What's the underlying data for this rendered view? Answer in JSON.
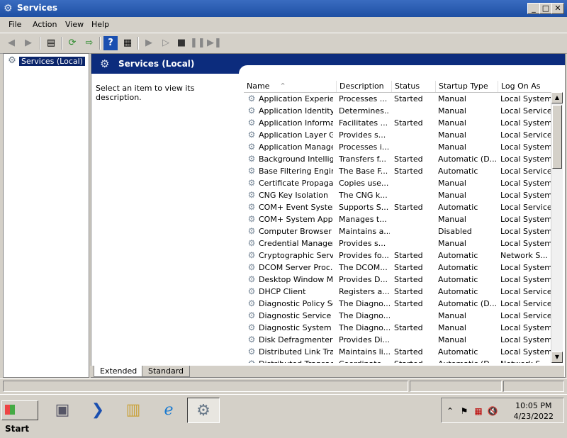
{
  "window": {
    "title": "Services"
  },
  "menu": [
    "File",
    "Action",
    "View",
    "Help"
  ],
  "tree": {
    "selected": "Services (Local)"
  },
  "header": {
    "title": "Services (Local)"
  },
  "description": {
    "hint": "Select an item to view its description."
  },
  "columns": {
    "name": "Name",
    "description": "Description",
    "status": "Status",
    "startup": "Startup Type",
    "logon": "Log On As"
  },
  "services": [
    {
      "name": "Application Experie...",
      "description": "Processes ...",
      "status": "Started",
      "startup": "Manual",
      "logon": "Local System"
    },
    {
      "name": "Application Identity",
      "description": "Determines...",
      "status": "",
      "startup": "Manual",
      "logon": "Local Service"
    },
    {
      "name": "Application Informa...",
      "description": "Facilitates ...",
      "status": "Started",
      "startup": "Manual",
      "logon": "Local System"
    },
    {
      "name": "Application Layer G...",
      "description": "Provides s...",
      "status": "",
      "startup": "Manual",
      "logon": "Local Service"
    },
    {
      "name": "Application Manage...",
      "description": "Processes i...",
      "status": "",
      "startup": "Manual",
      "logon": "Local System"
    },
    {
      "name": "Background Intellig...",
      "description": "Transfers f...",
      "status": "Started",
      "startup": "Automatic (D...",
      "logon": "Local System"
    },
    {
      "name": "Base Filtering Engine",
      "description": "The Base F...",
      "status": "Started",
      "startup": "Automatic",
      "logon": "Local Service"
    },
    {
      "name": "Certificate Propaga...",
      "description": "Copies use...",
      "status": "",
      "startup": "Manual",
      "logon": "Local System"
    },
    {
      "name": "CNG Key Isolation",
      "description": "The CNG k...",
      "status": "",
      "startup": "Manual",
      "logon": "Local System"
    },
    {
      "name": "COM+ Event System",
      "description": "Supports S...",
      "status": "Started",
      "startup": "Automatic",
      "logon": "Local Service"
    },
    {
      "name": "COM+ System Appl...",
      "description": "Manages t...",
      "status": "",
      "startup": "Manual",
      "logon": "Local System"
    },
    {
      "name": "Computer Browser",
      "description": "Maintains a...",
      "status": "",
      "startup": "Disabled",
      "logon": "Local System"
    },
    {
      "name": "Credential Manager",
      "description": "Provides s...",
      "status": "",
      "startup": "Manual",
      "logon": "Local System"
    },
    {
      "name": "Cryptographic Serv...",
      "description": "Provides fo...",
      "status": "Started",
      "startup": "Automatic",
      "logon": "Network S..."
    },
    {
      "name": "DCOM Server Proc...",
      "description": "The DCOM...",
      "status": "Started",
      "startup": "Automatic",
      "logon": "Local System"
    },
    {
      "name": "Desktop Window M...",
      "description": "Provides D...",
      "status": "Started",
      "startup": "Automatic",
      "logon": "Local System"
    },
    {
      "name": "DHCP Client",
      "description": "Registers a...",
      "status": "Started",
      "startup": "Automatic",
      "logon": "Local Service"
    },
    {
      "name": "Diagnostic Policy Se...",
      "description": "The Diagno...",
      "status": "Started",
      "startup": "Automatic (D...",
      "logon": "Local Service"
    },
    {
      "name": "Diagnostic Service ...",
      "description": "The Diagno...",
      "status": "",
      "startup": "Manual",
      "logon": "Local Service"
    },
    {
      "name": "Diagnostic System ...",
      "description": "The Diagno...",
      "status": "Started",
      "startup": "Manual",
      "logon": "Local System"
    },
    {
      "name": "Disk Defragmenter",
      "description": "Provides Di...",
      "status": "",
      "startup": "Manual",
      "logon": "Local System"
    },
    {
      "name": "Distributed Link Tra...",
      "description": "Maintains li...",
      "status": "Started",
      "startup": "Automatic",
      "logon": "Local System"
    },
    {
      "name": "Distributed Transac...",
      "description": "Coordinate...",
      "status": "Started",
      "startup": "Automatic (D...",
      "logon": "Network S..."
    }
  ],
  "tabs": [
    "Extended",
    "Standard"
  ],
  "taskbar": {
    "start": "Start",
    "time": "10:05 PM",
    "date": "4/23/2022"
  }
}
